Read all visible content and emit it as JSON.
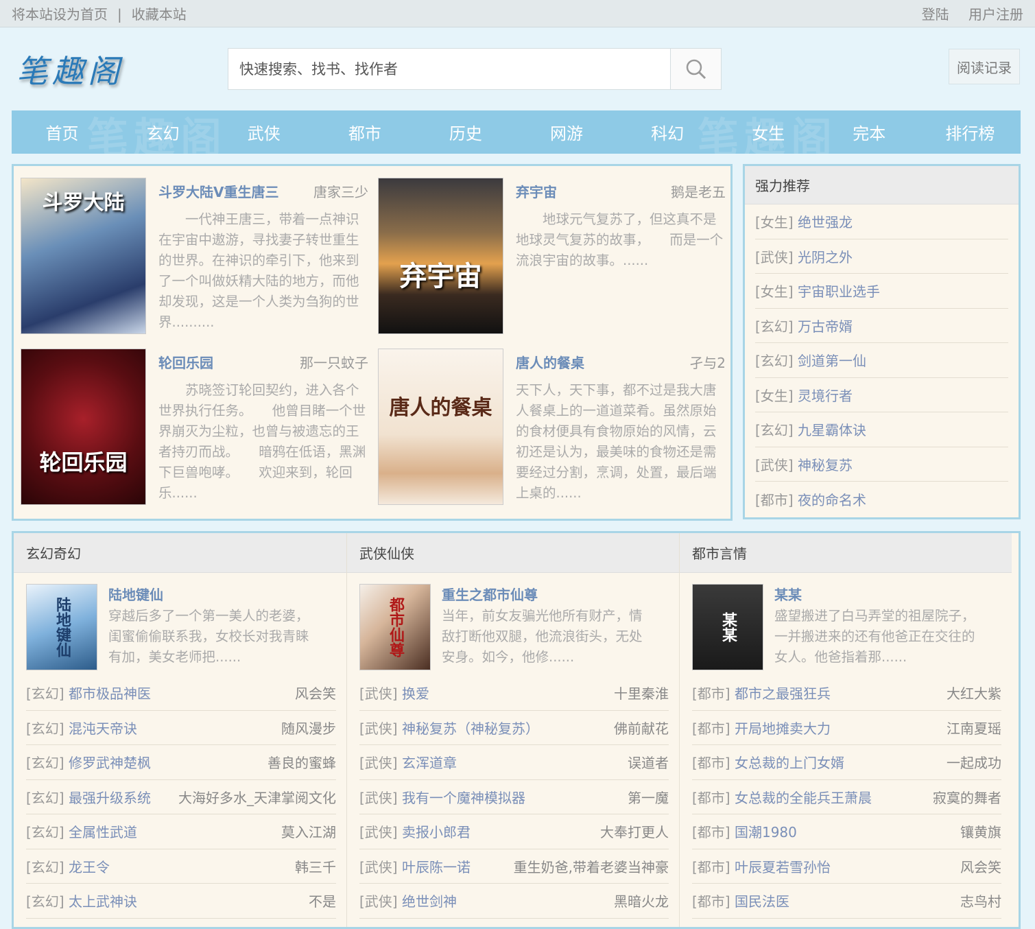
{
  "topbar": {
    "set_home": "将本站设为首页",
    "sep": "|",
    "bookmark": "收藏本站",
    "login": "登陆",
    "register": "用户注册"
  },
  "header": {
    "logo": "笔趣阁",
    "search_placeholder": "快速搜索、找书、找作者",
    "read_history": "阅读记录"
  },
  "nav": {
    "items": [
      "首页",
      "玄幻",
      "武侠",
      "都市",
      "历史",
      "网游",
      "科幻",
      "女生",
      "完本",
      "排行榜"
    ]
  },
  "featured": [
    {
      "title": "斗罗大陆V重生唐三",
      "author": "唐家三少",
      "desc": "　　一代神王唐三，带着一点神识在宇宙中遨游，寻找妻子转世重生的世界。在神识的牵引下，他来到了一个叫做妖精大陆的地方，而他却发现，这是一个人类为刍狗的世界..........",
      "cover_text": "斗罗大陆"
    },
    {
      "title": "弃宇宙",
      "author": "鹅是老五",
      "desc": "　　地球元气复苏了，但这真不是地球灵气复苏的故事，　　而是一个流浪宇宙的故事。......",
      "cover_text": "弃宇宙"
    },
    {
      "title": "轮回乐园",
      "author": "那一只蚊子",
      "desc": "　　苏晓签订轮回契约，进入各个世界执行任务。　　他曾目睹一个世界崩灭为尘粒，也曾与被遗忘的王者持刃而战。　　暗鸦在低语，黑渊下巨兽咆哮。　　欢迎来到，轮回乐......",
      "cover_text": "轮回乐园"
    },
    {
      "title": "唐人的餐桌",
      "author": "孑与2",
      "desc": "天下人，天下事，都不过是我大唐人餐桌上的一道道菜肴。虽然原始的食材便具有食物原始的风情，云初还是认为，最美味的食物还是需要经过分割，烹调，处置，最后端上桌的......",
      "cover_text": "唐人的餐桌"
    }
  ],
  "recommend": {
    "title": "强力推荐",
    "items": [
      {
        "cat": "[女生]",
        "name": "绝世强龙"
      },
      {
        "cat": "[武侠]",
        "name": "光阴之外"
      },
      {
        "cat": "[女生]",
        "name": "宇宙职业选手"
      },
      {
        "cat": "[玄幻]",
        "name": "万古帝婿"
      },
      {
        "cat": "[玄幻]",
        "name": "剑道第一仙"
      },
      {
        "cat": "[女生]",
        "name": "灵境行者"
      },
      {
        "cat": "[玄幻]",
        "name": "九星霸体诀"
      },
      {
        "cat": "[武侠]",
        "name": "神秘复苏"
      },
      {
        "cat": "[都市]",
        "name": "夜的命名术"
      }
    ]
  },
  "categories": [
    {
      "title": "玄幻奇幻",
      "feature": {
        "title": "陆地键仙",
        "desc_lines": [
          "穿越后多了一个第一美人的老婆，",
          "闺蜜偷偷联系我，女校长对我青睐",
          "有加，美女老师把......"
        ],
        "cover_text": "陆地键仙"
      },
      "items": [
        {
          "cat": "[玄幻]",
          "name": "都市极品神医",
          "author": "风会笑"
        },
        {
          "cat": "[玄幻]",
          "name": "混沌天帝诀",
          "author": "随风漫步"
        },
        {
          "cat": "[玄幻]",
          "name": "修罗武神楚枫",
          "author": "善良的蜜蜂"
        },
        {
          "cat": "[玄幻]",
          "name": "最强升级系统",
          "author": "大海好多水_天津掌阅文化"
        },
        {
          "cat": "[玄幻]",
          "name": "全属性武道",
          "author": "莫入江湖"
        },
        {
          "cat": "[玄幻]",
          "name": "龙王令",
          "author": "韩三千"
        },
        {
          "cat": "[玄幻]",
          "name": "太上武神诀",
          "author": "不是"
        }
      ]
    },
    {
      "title": "武侠仙侠",
      "feature": {
        "title": "重生之都市仙尊",
        "desc_lines": [
          "当年，前女友骗光他所有财产，情",
          "敌打断他双腿，他流浪街头，无处",
          "安身。如今，他修......"
        ],
        "cover_text": "都市仙尊"
      },
      "items": [
        {
          "cat": "[武侠]",
          "name": "换爱",
          "author": "十里秦淮"
        },
        {
          "cat": "[武侠]",
          "name": "神秘复苏（神秘复苏）",
          "author": "佛前献花"
        },
        {
          "cat": "[武侠]",
          "name": "玄浑道章",
          "author": "误道者"
        },
        {
          "cat": "[武侠]",
          "name": "我有一个魔神模拟器",
          "author": "第一魔"
        },
        {
          "cat": "[武侠]",
          "name": "卖报小郎君",
          "author": "大奉打更人"
        },
        {
          "cat": "[武侠]",
          "name": "叶辰陈一诺",
          "author": "重生奶爸,带着老婆当神豪"
        },
        {
          "cat": "[武侠]",
          "name": "绝世剑神",
          "author": "黑暗火龙"
        }
      ]
    },
    {
      "title": "都市言情",
      "feature": {
        "title": "某某",
        "desc_lines": [
          "盛望搬进了白马弄堂的祖屋院子，",
          "一并搬进来的还有他爸正在交往的",
          "女人。他爸指着那......"
        ],
        "cover_text": "某某"
      },
      "items": [
        {
          "cat": "[都市]",
          "name": "都市之最强狂兵",
          "author": "大红大紫"
        },
        {
          "cat": "[都市]",
          "name": "开局地摊卖大力",
          "author": "江南夏瑶"
        },
        {
          "cat": "[都市]",
          "name": "女总裁的上门女婿",
          "author": "一起成功"
        },
        {
          "cat": "[都市]",
          "name": "女总裁的全能兵王萧晨",
          "author": "寂寞的舞者"
        },
        {
          "cat": "[都市]",
          "name": "国潮1980",
          "author": "镶黄旗"
        },
        {
          "cat": "[都市]",
          "name": "叶辰夏若雪孙怡",
          "author": "风会笑"
        },
        {
          "cat": "[都市]",
          "name": "国民法医",
          "author": "志鸟村"
        }
      ]
    }
  ],
  "colors": {
    "nav_bg": "#8ecae6",
    "panel_border": "#a8d5e6",
    "panel_bg": "#fbf6ec",
    "link": "#6b8cb8"
  }
}
